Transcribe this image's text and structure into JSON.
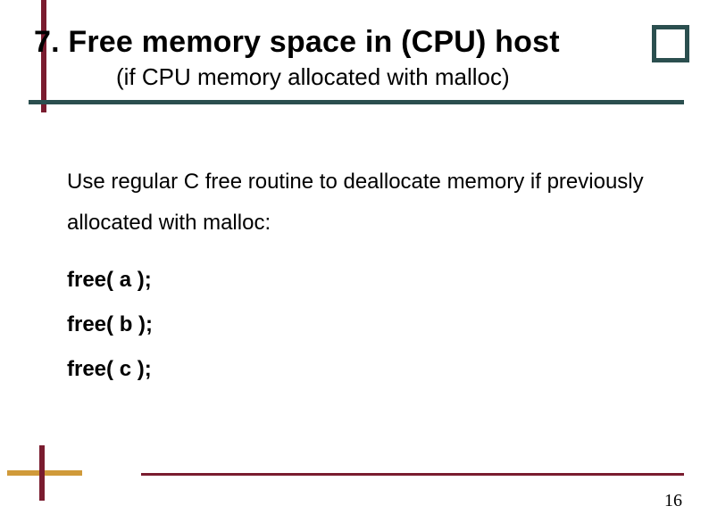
{
  "header": {
    "title": "7. Free memory space in (CPU) host",
    "subtitle": "(if CPU memory allocated with malloc)"
  },
  "body": {
    "paragraph": "Use regular C free routine to deallocate memory if previously allocated with malloc:",
    "code": [
      "free( a );",
      "free( b );",
      "free( c );"
    ]
  },
  "footer": {
    "page_number": "16"
  },
  "colors": {
    "divider_teal": "#2b4f4f",
    "accent_maroon": "#7a1c2f",
    "accent_gold": "#d09a3a"
  }
}
